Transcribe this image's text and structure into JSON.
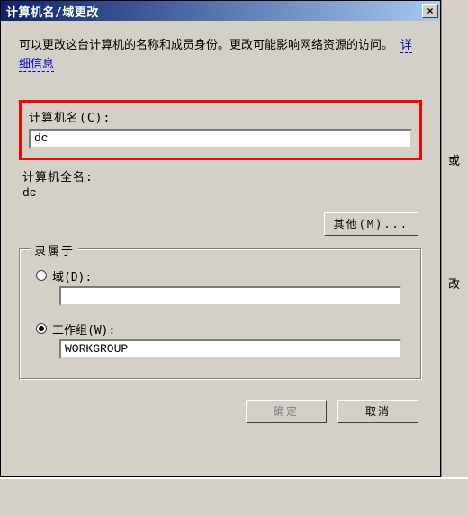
{
  "window": {
    "title": "计算机名/域更改",
    "close_btn": "×"
  },
  "info": {
    "text1": "可以更改这台计算机的名称和成员身份。更改可能影响网络资源的访问。",
    "link": "详细信息"
  },
  "computer_name": {
    "label": "计算机名(C):",
    "value": "dc"
  },
  "full_name": {
    "label": "计算机全名:",
    "value": "dc"
  },
  "more_btn": "其他(M)...",
  "member_of": {
    "legend": "隶属于",
    "domain_label": "域(D):",
    "domain_value": "",
    "workgroup_label": "工作组(W):",
    "workgroup_value": "WORKGROUP",
    "selected": "workgroup"
  },
  "buttons": {
    "ok": "确定",
    "cancel": "取消"
  },
  "bg": {
    "frag1": "或",
    "frag2": "改"
  }
}
